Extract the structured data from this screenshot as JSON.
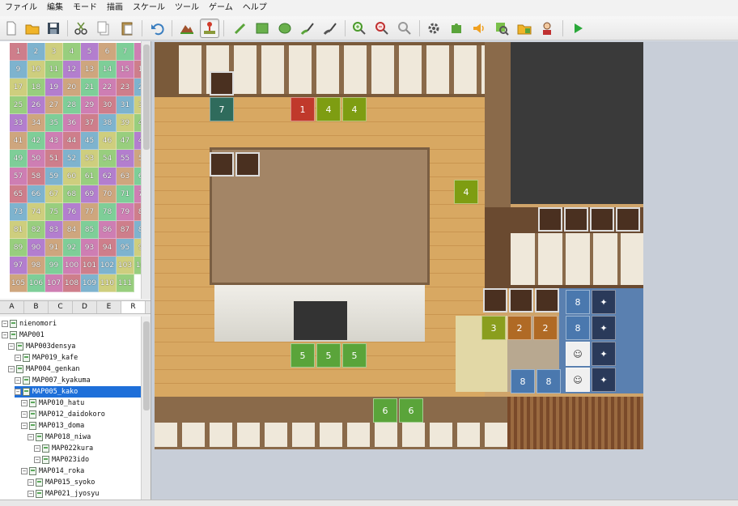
{
  "menu": [
    "ファイル",
    "編集",
    "モード",
    "描画",
    "スケール",
    "ツール",
    "ゲーム",
    "ヘルプ"
  ],
  "toolbar": {
    "icons": [
      "new-project-icon",
      "open-project-icon",
      "save-project-icon",
      "cut-icon",
      "copy-icon",
      "paste-icon",
      "undo-icon",
      "map-mode-icon",
      "event-mode-icon",
      "pencil-icon",
      "rectangle-icon",
      "ellipse-icon",
      "fill-icon",
      "shadow-pen-icon",
      "zoom-in-icon",
      "zoom-out-icon",
      "actual-size-icon",
      "database-icon",
      "plugin-manager-icon",
      "sound-test-icon",
      "event-searcher-icon",
      "resource-manager-icon",
      "character-generator-icon",
      "playtest-icon"
    ]
  },
  "palette": {
    "first_number": 1,
    "last_number": 111,
    "columns": 8
  },
  "tabs": [
    "A",
    "B",
    "C",
    "D",
    "E",
    "R"
  ],
  "active_tab": "R",
  "tree": [
    {
      "label": "nienomori",
      "depth": 0
    },
    {
      "label": "MAP001",
      "depth": 0
    },
    {
      "label": "MAP003densya",
      "depth": 1
    },
    {
      "label": "MAP019_kafe",
      "depth": 2
    },
    {
      "label": "MAP004_genkan",
      "depth": 1
    },
    {
      "label": "MAP007_kyakuma",
      "depth": 2
    },
    {
      "label": "MAP005_kako",
      "depth": 2,
      "selected": true
    },
    {
      "label": "MAP010_hatu",
      "depth": 3
    },
    {
      "label": "MAP012_daidokoro",
      "depth": 3
    },
    {
      "label": "MAP013_doma",
      "depth": 3
    },
    {
      "label": "MAP018_niwa",
      "depth": 4
    },
    {
      "label": "MAP022kura",
      "depth": 5
    },
    {
      "label": "MAP023ido",
      "depth": 5
    },
    {
      "label": "MAP014_roka",
      "depth": 3
    },
    {
      "label": "MAP015_syoko",
      "depth": 4
    },
    {
      "label": "MAP021_jyosyu",
      "depth": 4
    }
  ],
  "map_events": [
    {
      "label": "7",
      "color": "#2f6b5c"
    },
    {
      "label": "1",
      "color": "#c0392b"
    },
    {
      "label": "4",
      "color": "#7e9d12"
    },
    {
      "label": "4",
      "color": "#7e9d12"
    },
    {
      "label": "4",
      "color": "#7e9d12"
    },
    {
      "label": "3",
      "color": "#8a9e1e"
    },
    {
      "label": "2",
      "color": "#b06a25"
    },
    {
      "label": "2",
      "color": "#b06a25"
    },
    {
      "label": "8",
      "color": "#4a78ae"
    },
    {
      "label": "8",
      "color": "#4a78ae"
    },
    {
      "label": "8",
      "color": "#4a78ae"
    },
    {
      "label": "8",
      "color": "#4a78ae"
    },
    {
      "label": "5",
      "color": "#5aa43a"
    },
    {
      "label": "5",
      "color": "#5aa43a"
    },
    {
      "label": "5",
      "color": "#5aa43a"
    },
    {
      "label": "6",
      "color": "#5aa43a"
    },
    {
      "label": "6",
      "color": "#5aa43a"
    }
  ],
  "status": {
    "map": "",
    "zoom": "",
    "coords": "",
    "event": ""
  }
}
